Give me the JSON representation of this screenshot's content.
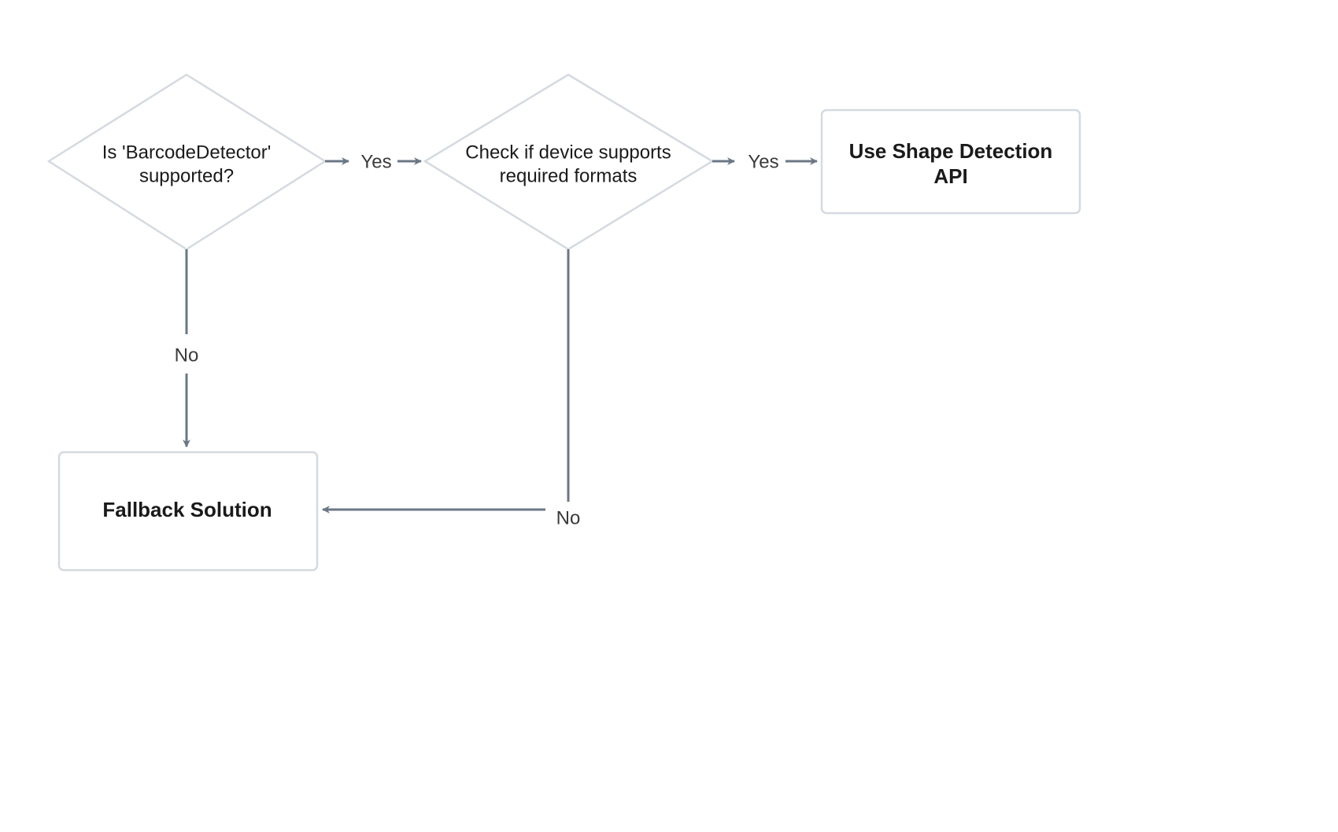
{
  "nodes": {
    "decision1": {
      "line1": "Is 'BarcodeDetector'",
      "line2": "supported?"
    },
    "decision2": {
      "line1": "Check if device supports",
      "line2": "required formats"
    },
    "action1": {
      "line1": "Use Shape Detection",
      "line2": "API"
    },
    "action2": {
      "text": "Fallback Solution"
    }
  },
  "edges": {
    "d1_yes": "Yes",
    "d1_no": "No",
    "d2_yes": "Yes",
    "d2_no": "No"
  },
  "colors": {
    "stroke": "#d5dae0",
    "arrow": "#6b7785",
    "text": "#1a1a1a"
  }
}
